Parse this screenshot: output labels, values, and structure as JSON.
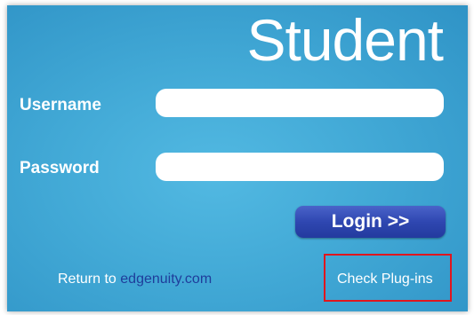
{
  "header": {
    "title": "Student"
  },
  "form": {
    "username_label": "Username",
    "password_label": "Password",
    "username_value": "",
    "password_value": "",
    "login_label": "Login >>"
  },
  "footer": {
    "return_text": "Return to ",
    "return_link": "edgenuity.com",
    "check_plugins": "Check Plug-ins"
  },
  "colors": {
    "panel": "#42a9d6",
    "button": "#2f47b1",
    "link": "#1f3d9b",
    "highlight_border": "#e0161e"
  }
}
